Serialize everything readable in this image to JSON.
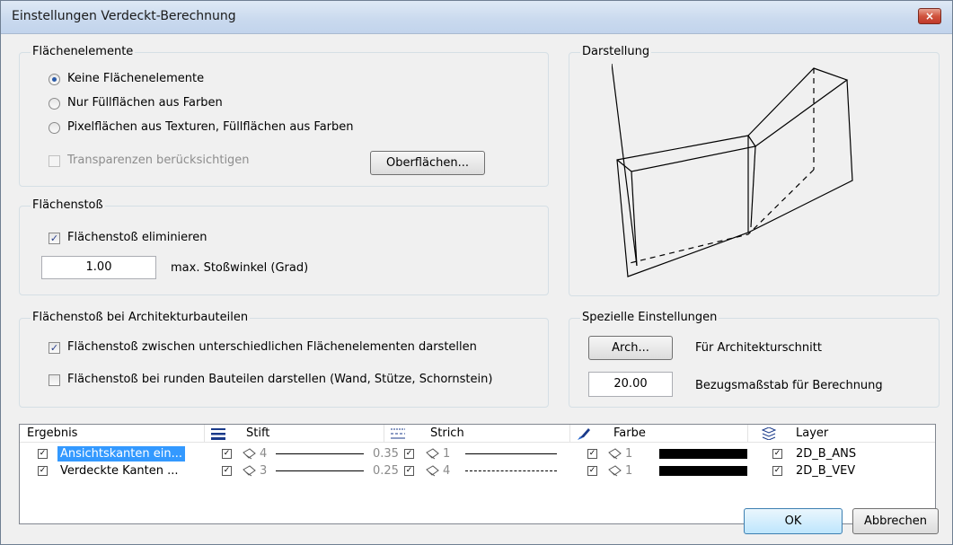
{
  "window": {
    "title": "Einstellungen Verdeckt-Berechnung",
    "close_label": "×"
  },
  "flaechenelemente": {
    "label": "Flächenelemente",
    "options": [
      {
        "label": "Keine Flächenelemente",
        "selected": true
      },
      {
        "label": "Nur Füllflächen aus Farben",
        "selected": false
      },
      {
        "label": "Pixelflächen aus Texturen, Füllflächen aus Farben",
        "selected": false
      }
    ],
    "transparency_label": "Transparenzen berücksichtigen",
    "transparency_checked": false,
    "surfaces_button": "Oberflächen..."
  },
  "flaechenstoss": {
    "label": "Flächenstoß",
    "eliminate_label": "Flächenstoß eliminieren",
    "eliminate_checked": true,
    "angle_value": "1.00",
    "angle_label": "max. Stoßwinkel (Grad)"
  },
  "architektur": {
    "label": "Flächenstoß bei Architekturbauteilen",
    "option1_label": "Flächenstoß zwischen unterschiedlichen Flächenelementen darstellen",
    "option1_checked": true,
    "option2_label": "Flächenstoß bei runden Bauteilen darstellen (Wand, Stütze, Schornstein)",
    "option2_checked": false
  },
  "darstellung": {
    "label": "Darstellung"
  },
  "spezielle": {
    "label": "Spezielle Einstellungen",
    "arch_button": "Arch...",
    "arch_label": "Für Architekturschnitt",
    "scale_value": "20.00",
    "scale_label": "Bezugsmaßstab für Berechnung"
  },
  "results_table": {
    "headers": {
      "ergebnis": "Ergebnis",
      "stift": "Stift",
      "strich": "Strich",
      "farbe": "Farbe",
      "layer": "Layer"
    },
    "rows": [
      {
        "name": "Ansichtskanten ein...",
        "selected": true,
        "pen": "4",
        "pen_thickness": "0.35",
        "stroke": "1",
        "stroke_style": "solid",
        "color": "1",
        "layer": "2D_B_ANS"
      },
      {
        "name": "Verdeckte Kanten ...",
        "selected": false,
        "pen": "3",
        "pen_thickness": "0.25",
        "stroke": "4",
        "stroke_style": "dashed",
        "color": "1",
        "layer": "2D_B_VEV"
      }
    ]
  },
  "footer": {
    "ok_label": "OK",
    "cancel_label": "Abbrechen"
  },
  "colors": {
    "selection": "#3399ff",
    "accent": "#2a5aa8"
  }
}
